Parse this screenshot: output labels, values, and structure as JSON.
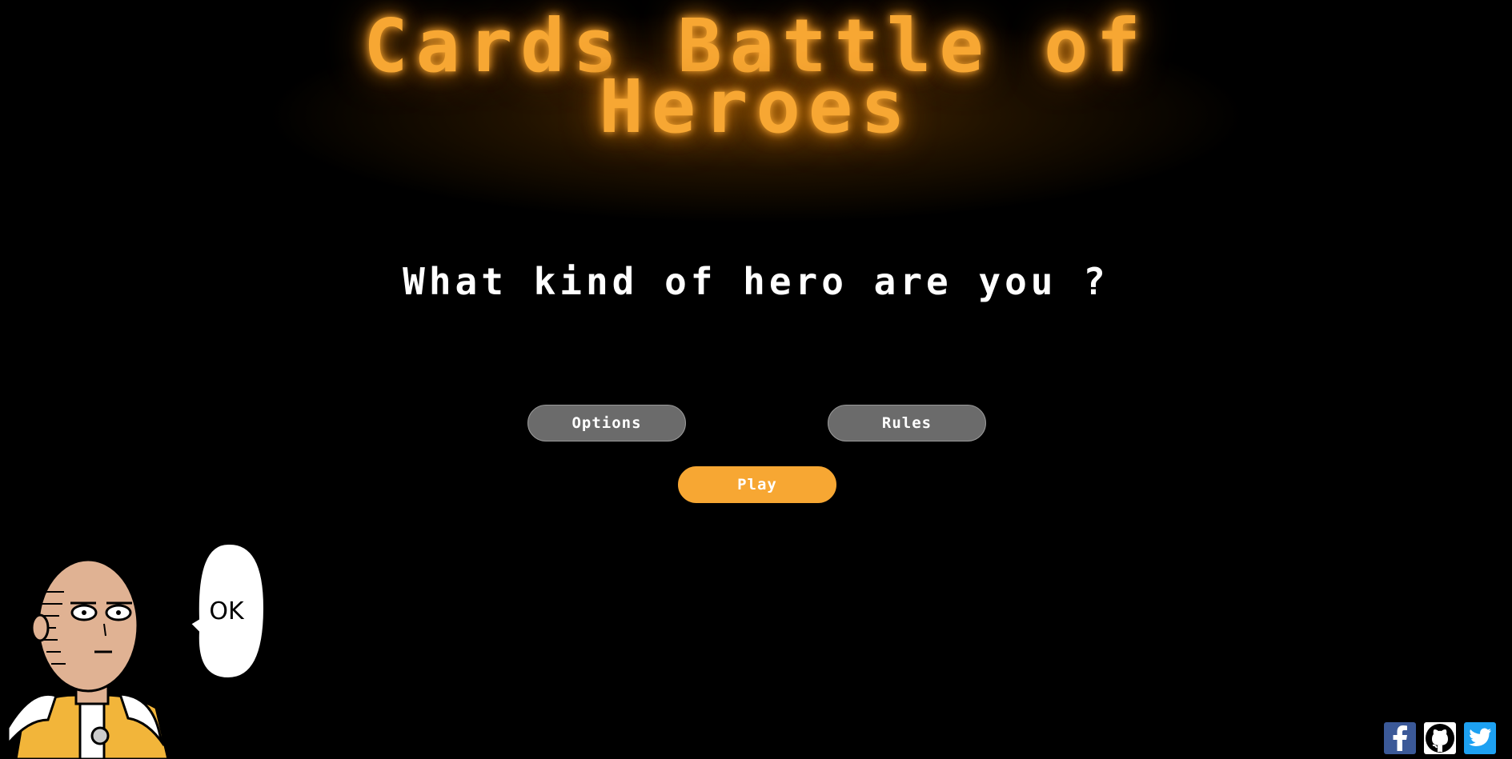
{
  "title": {
    "line1": "Cards Battle of",
    "line2": "Heroes"
  },
  "subtitle": "What kind of hero are you ?",
  "buttons": {
    "options": "Options",
    "rules": "Rules",
    "play": "Play"
  },
  "hero": {
    "speech": "OK",
    "icon": "saitama-ok-illustration"
  },
  "social": [
    {
      "name": "facebook",
      "icon": "facebook-icon"
    },
    {
      "name": "github",
      "icon": "github-icon"
    },
    {
      "name": "twitter",
      "icon": "twitter-icon"
    }
  ],
  "colors": {
    "accent": "#f7a733",
    "background": "#000000",
    "button_grey": "#6b6b6b"
  }
}
